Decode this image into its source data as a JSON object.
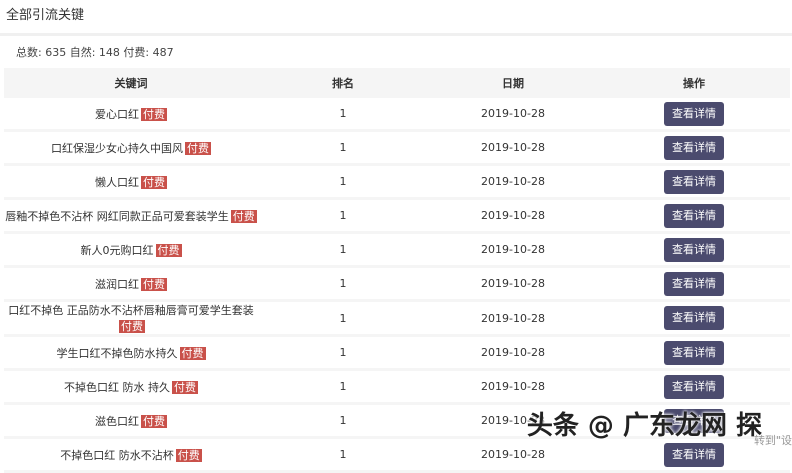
{
  "page": {
    "title": "全部引流关键",
    "summary": "总数: 635 自然: 148 付费: 487"
  },
  "table": {
    "headers": [
      "关键词",
      "排名",
      "日期",
      "操作"
    ],
    "tag_label": "付费",
    "button_label": "查看详情",
    "rows": [
      {
        "keyword": "爱心口红",
        "rank": "1",
        "date": "2019-10-28"
      },
      {
        "keyword": "口红保湿少女心持久中国风",
        "rank": "1",
        "date": "2019-10-28"
      },
      {
        "keyword": "懒人口红",
        "rank": "1",
        "date": "2019-10-28"
      },
      {
        "keyword": "唇釉不掉色不沾杯 网红同款正品可爱套装学生",
        "rank": "1",
        "date": "2019-10-28"
      },
      {
        "keyword": "新人0元购口红",
        "rank": "1",
        "date": "2019-10-28"
      },
      {
        "keyword": "滋润口红",
        "rank": "1",
        "date": "2019-10-28"
      },
      {
        "keyword": "口红不掉色 正品防水不沾杯唇釉唇膏可爱学生套装",
        "rank": "1",
        "date": "2019-10-28"
      },
      {
        "keyword": "学生口红不掉色防水持久",
        "rank": "1",
        "date": "2019-10-28"
      },
      {
        "keyword": "不掉色口红 防水 持久",
        "rank": "1",
        "date": "2019-10-28"
      },
      {
        "keyword": "滋色口红",
        "rank": "1",
        "date": "2019-10-28"
      },
      {
        "keyword": "不掉色口红 防水不沾杯",
        "rank": "1",
        "date": "2019-10-28"
      }
    ]
  },
  "watermark": {
    "text": "头条 @ 广东龙网 探",
    "sub": "转到\"设"
  }
}
